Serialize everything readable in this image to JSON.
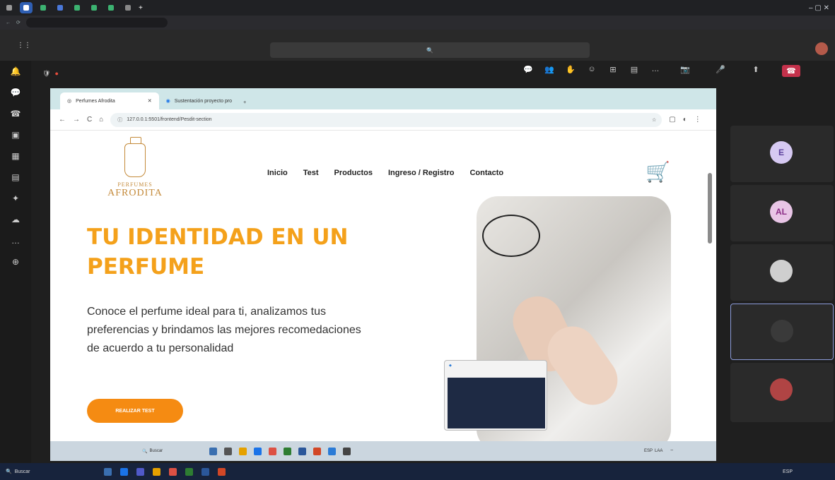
{
  "shared_browser": {
    "tabs": [
      {
        "label": "Perfumes Afrodita"
      },
      {
        "label": "Sustentación proyecto pro"
      }
    ],
    "url": "127.0.0.1:5501/frontend/Pesdit-section"
  },
  "site": {
    "logo": {
      "line1": "PERFUMES",
      "line2": "AFRODITA"
    },
    "nav": [
      "Inicio",
      "Test",
      "Productos",
      "Ingreso / Registro",
      "Contacto"
    ],
    "hero_title": "TU IDENTIDAD EN UN PERFUME",
    "hero_description": "Conoce el perfume ideal para ti, analizamos tus preferencias y brindamos las mejores recomedaciones de acuerdo a tu personalidad",
    "cta": "REALIZAR TEST"
  },
  "participants": [
    {
      "initials": "E"
    },
    {
      "initials": "AL"
    }
  ],
  "shared_taskbar": {
    "search": "Buscar",
    "lang": "ESP",
    "lang2": "LAA"
  },
  "os_taskbar": {
    "search": "Buscar",
    "lang": "ESP"
  },
  "colors": {
    "accent": "#f4a11b",
    "cta": "#f58b12",
    "logo": "#c48a3a",
    "leave": "#c4314b"
  }
}
